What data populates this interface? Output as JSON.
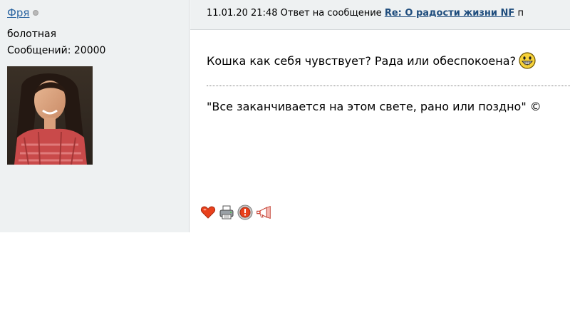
{
  "author": {
    "name": "Фря",
    "rank": "болотная",
    "posts_label": "Сообщений:",
    "posts_count": "20000"
  },
  "header": {
    "timestamp": "11.01.20 21:48",
    "reply_prefix": "Ответ на сообщение",
    "reply_title": "Re: О радости жизни NF",
    "trailing": "п"
  },
  "message": {
    "text": "Кошка как себя чувствует? Рада или обеспокоена?",
    "smiley_icon": "grin-smiley-icon"
  },
  "signature": {
    "text": "\"Все заканчивается на этом свете, рано или поздно\" ©"
  },
  "actions": [
    {
      "icon": "heart-icon"
    },
    {
      "icon": "printer-icon"
    },
    {
      "icon": "warning-icon"
    },
    {
      "icon": "megaphone-icon"
    }
  ],
  "colors": {
    "sidebar_bg": "#eef1f2",
    "link": "#2a64a0",
    "reply_link": "#1f4d7d"
  }
}
